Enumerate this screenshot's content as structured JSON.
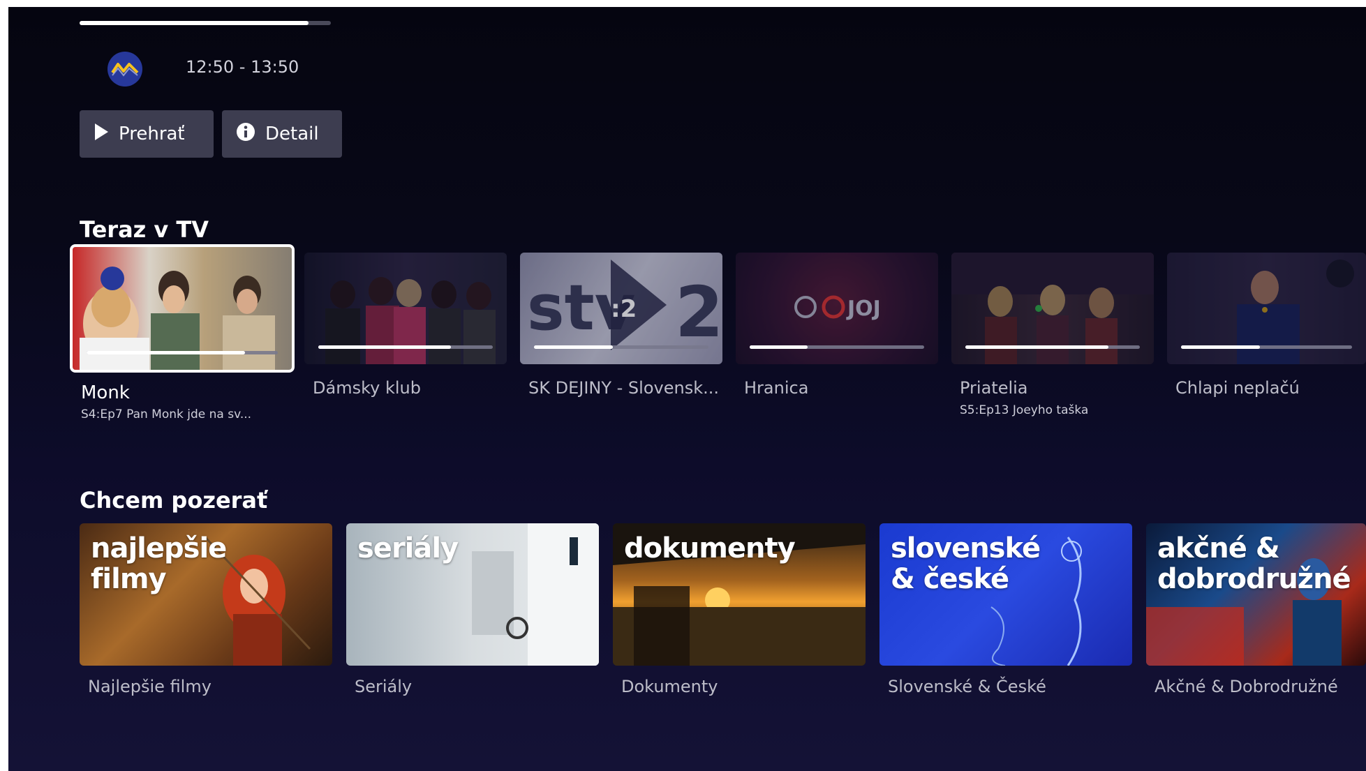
{
  "hero": {
    "time_range": "12:50 - 13:50",
    "progress": 0.91,
    "buttons": {
      "play_label": "Prehrať",
      "detail_label": "Detail"
    }
  },
  "sections": {
    "now_on_tv": "Teraz v TV",
    "want_to_watch": "Chcem pozerať"
  },
  "now_on_tv": [
    {
      "title": "Monk",
      "subtitle": "S4:Ep7 Pan Monk jde na sv...",
      "progress": 0.83
    },
    {
      "title": "Dámsky klub",
      "subtitle": "",
      "progress": 0.76
    },
    {
      "title": "SK DEJINY - Slovensk...",
      "subtitle": "",
      "progress": 0.45,
      "logo_text": "stv",
      "logo_num": ":2",
      "logo_big": "2"
    },
    {
      "title": "Hranica",
      "subtitle": "",
      "progress": 0.33,
      "logo_text": "JOJ"
    },
    {
      "title": "Priatelia",
      "subtitle": "S5:Ep13 Joeyho taška",
      "progress": 0.82
    },
    {
      "title": "Chlapi neplačú",
      "subtitle": "",
      "progress": 0.46
    }
  ],
  "genres": [
    {
      "overlay": "najlepšie filmy",
      "label": "Najlepšie filmy"
    },
    {
      "overlay": "seriály",
      "label": "Seriály"
    },
    {
      "overlay": "dokumenty",
      "label": "Dokumenty"
    },
    {
      "overlay": "slovenské & české",
      "label": "Slovenské & České"
    },
    {
      "overlay": "akčné & dobrodružné",
      "label": "Akčné & Dobrodružné"
    }
  ],
  "colors": {
    "background": "#0d0c2a",
    "accent": "#ffffff",
    "button_bg": "#3d3d50",
    "logo_blue": "#27389a",
    "logo_yellow": "#f7c21d"
  },
  "icons": [
    "channel-logo-icon",
    "play-icon",
    "info-icon"
  ]
}
